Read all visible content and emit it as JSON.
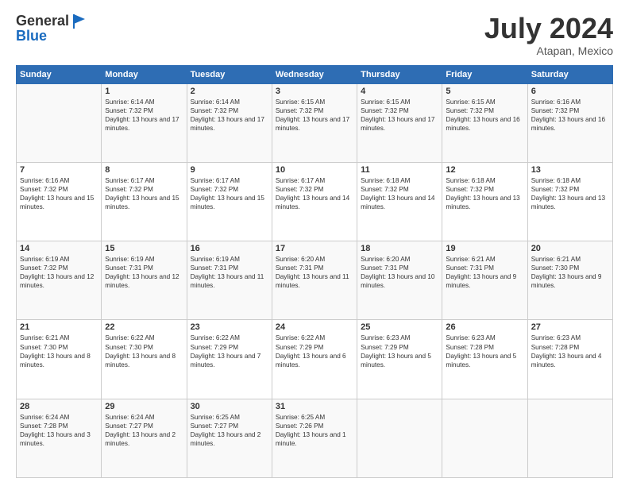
{
  "header": {
    "logo_line1": "General",
    "logo_line2": "Blue",
    "month_year": "July 2024",
    "location": "Atapan, Mexico"
  },
  "days_of_week": [
    "Sunday",
    "Monday",
    "Tuesday",
    "Wednesday",
    "Thursday",
    "Friday",
    "Saturday"
  ],
  "weeks": [
    [
      {
        "day": "",
        "sunrise": "",
        "sunset": "",
        "daylight": ""
      },
      {
        "day": "1",
        "sunrise": "Sunrise: 6:14 AM",
        "sunset": "Sunset: 7:32 PM",
        "daylight": "Daylight: 13 hours and 17 minutes."
      },
      {
        "day": "2",
        "sunrise": "Sunrise: 6:14 AM",
        "sunset": "Sunset: 7:32 PM",
        "daylight": "Daylight: 13 hours and 17 minutes."
      },
      {
        "day": "3",
        "sunrise": "Sunrise: 6:15 AM",
        "sunset": "Sunset: 7:32 PM",
        "daylight": "Daylight: 13 hours and 17 minutes."
      },
      {
        "day": "4",
        "sunrise": "Sunrise: 6:15 AM",
        "sunset": "Sunset: 7:32 PM",
        "daylight": "Daylight: 13 hours and 17 minutes."
      },
      {
        "day": "5",
        "sunrise": "Sunrise: 6:15 AM",
        "sunset": "Sunset: 7:32 PM",
        "daylight": "Daylight: 13 hours and 16 minutes."
      },
      {
        "day": "6",
        "sunrise": "Sunrise: 6:16 AM",
        "sunset": "Sunset: 7:32 PM",
        "daylight": "Daylight: 13 hours and 16 minutes."
      }
    ],
    [
      {
        "day": "7",
        "sunrise": "Sunrise: 6:16 AM",
        "sunset": "Sunset: 7:32 PM",
        "daylight": "Daylight: 13 hours and 15 minutes."
      },
      {
        "day": "8",
        "sunrise": "Sunrise: 6:17 AM",
        "sunset": "Sunset: 7:32 PM",
        "daylight": "Daylight: 13 hours and 15 minutes."
      },
      {
        "day": "9",
        "sunrise": "Sunrise: 6:17 AM",
        "sunset": "Sunset: 7:32 PM",
        "daylight": "Daylight: 13 hours and 15 minutes."
      },
      {
        "day": "10",
        "sunrise": "Sunrise: 6:17 AM",
        "sunset": "Sunset: 7:32 PM",
        "daylight": "Daylight: 13 hours and 14 minutes."
      },
      {
        "day": "11",
        "sunrise": "Sunrise: 6:18 AM",
        "sunset": "Sunset: 7:32 PM",
        "daylight": "Daylight: 13 hours and 14 minutes."
      },
      {
        "day": "12",
        "sunrise": "Sunrise: 6:18 AM",
        "sunset": "Sunset: 7:32 PM",
        "daylight": "Daylight: 13 hours and 13 minutes."
      },
      {
        "day": "13",
        "sunrise": "Sunrise: 6:18 AM",
        "sunset": "Sunset: 7:32 PM",
        "daylight": "Daylight: 13 hours and 13 minutes."
      }
    ],
    [
      {
        "day": "14",
        "sunrise": "Sunrise: 6:19 AM",
        "sunset": "Sunset: 7:32 PM",
        "daylight": "Daylight: 13 hours and 12 minutes."
      },
      {
        "day": "15",
        "sunrise": "Sunrise: 6:19 AM",
        "sunset": "Sunset: 7:31 PM",
        "daylight": "Daylight: 13 hours and 12 minutes."
      },
      {
        "day": "16",
        "sunrise": "Sunrise: 6:19 AM",
        "sunset": "Sunset: 7:31 PM",
        "daylight": "Daylight: 13 hours and 11 minutes."
      },
      {
        "day": "17",
        "sunrise": "Sunrise: 6:20 AM",
        "sunset": "Sunset: 7:31 PM",
        "daylight": "Daylight: 13 hours and 11 minutes."
      },
      {
        "day": "18",
        "sunrise": "Sunrise: 6:20 AM",
        "sunset": "Sunset: 7:31 PM",
        "daylight": "Daylight: 13 hours and 10 minutes."
      },
      {
        "day": "19",
        "sunrise": "Sunrise: 6:21 AM",
        "sunset": "Sunset: 7:31 PM",
        "daylight": "Daylight: 13 hours and 9 minutes."
      },
      {
        "day": "20",
        "sunrise": "Sunrise: 6:21 AM",
        "sunset": "Sunset: 7:30 PM",
        "daylight": "Daylight: 13 hours and 9 minutes."
      }
    ],
    [
      {
        "day": "21",
        "sunrise": "Sunrise: 6:21 AM",
        "sunset": "Sunset: 7:30 PM",
        "daylight": "Daylight: 13 hours and 8 minutes."
      },
      {
        "day": "22",
        "sunrise": "Sunrise: 6:22 AM",
        "sunset": "Sunset: 7:30 PM",
        "daylight": "Daylight: 13 hours and 8 minutes."
      },
      {
        "day": "23",
        "sunrise": "Sunrise: 6:22 AM",
        "sunset": "Sunset: 7:29 PM",
        "daylight": "Daylight: 13 hours and 7 minutes."
      },
      {
        "day": "24",
        "sunrise": "Sunrise: 6:22 AM",
        "sunset": "Sunset: 7:29 PM",
        "daylight": "Daylight: 13 hours and 6 minutes."
      },
      {
        "day": "25",
        "sunrise": "Sunrise: 6:23 AM",
        "sunset": "Sunset: 7:29 PM",
        "daylight": "Daylight: 13 hours and 5 minutes."
      },
      {
        "day": "26",
        "sunrise": "Sunrise: 6:23 AM",
        "sunset": "Sunset: 7:28 PM",
        "daylight": "Daylight: 13 hours and 5 minutes."
      },
      {
        "day": "27",
        "sunrise": "Sunrise: 6:23 AM",
        "sunset": "Sunset: 7:28 PM",
        "daylight": "Daylight: 13 hours and 4 minutes."
      }
    ],
    [
      {
        "day": "28",
        "sunrise": "Sunrise: 6:24 AM",
        "sunset": "Sunset: 7:28 PM",
        "daylight": "Daylight: 13 hours and 3 minutes."
      },
      {
        "day": "29",
        "sunrise": "Sunrise: 6:24 AM",
        "sunset": "Sunset: 7:27 PM",
        "daylight": "Daylight: 13 hours and 2 minutes."
      },
      {
        "day": "30",
        "sunrise": "Sunrise: 6:25 AM",
        "sunset": "Sunset: 7:27 PM",
        "daylight": "Daylight: 13 hours and 2 minutes."
      },
      {
        "day": "31",
        "sunrise": "Sunrise: 6:25 AM",
        "sunset": "Sunset: 7:26 PM",
        "daylight": "Daylight: 13 hours and 1 minute."
      },
      {
        "day": "",
        "sunrise": "",
        "sunset": "",
        "daylight": ""
      },
      {
        "day": "",
        "sunrise": "",
        "sunset": "",
        "daylight": ""
      },
      {
        "day": "",
        "sunrise": "",
        "sunset": "",
        "daylight": ""
      }
    ]
  ]
}
